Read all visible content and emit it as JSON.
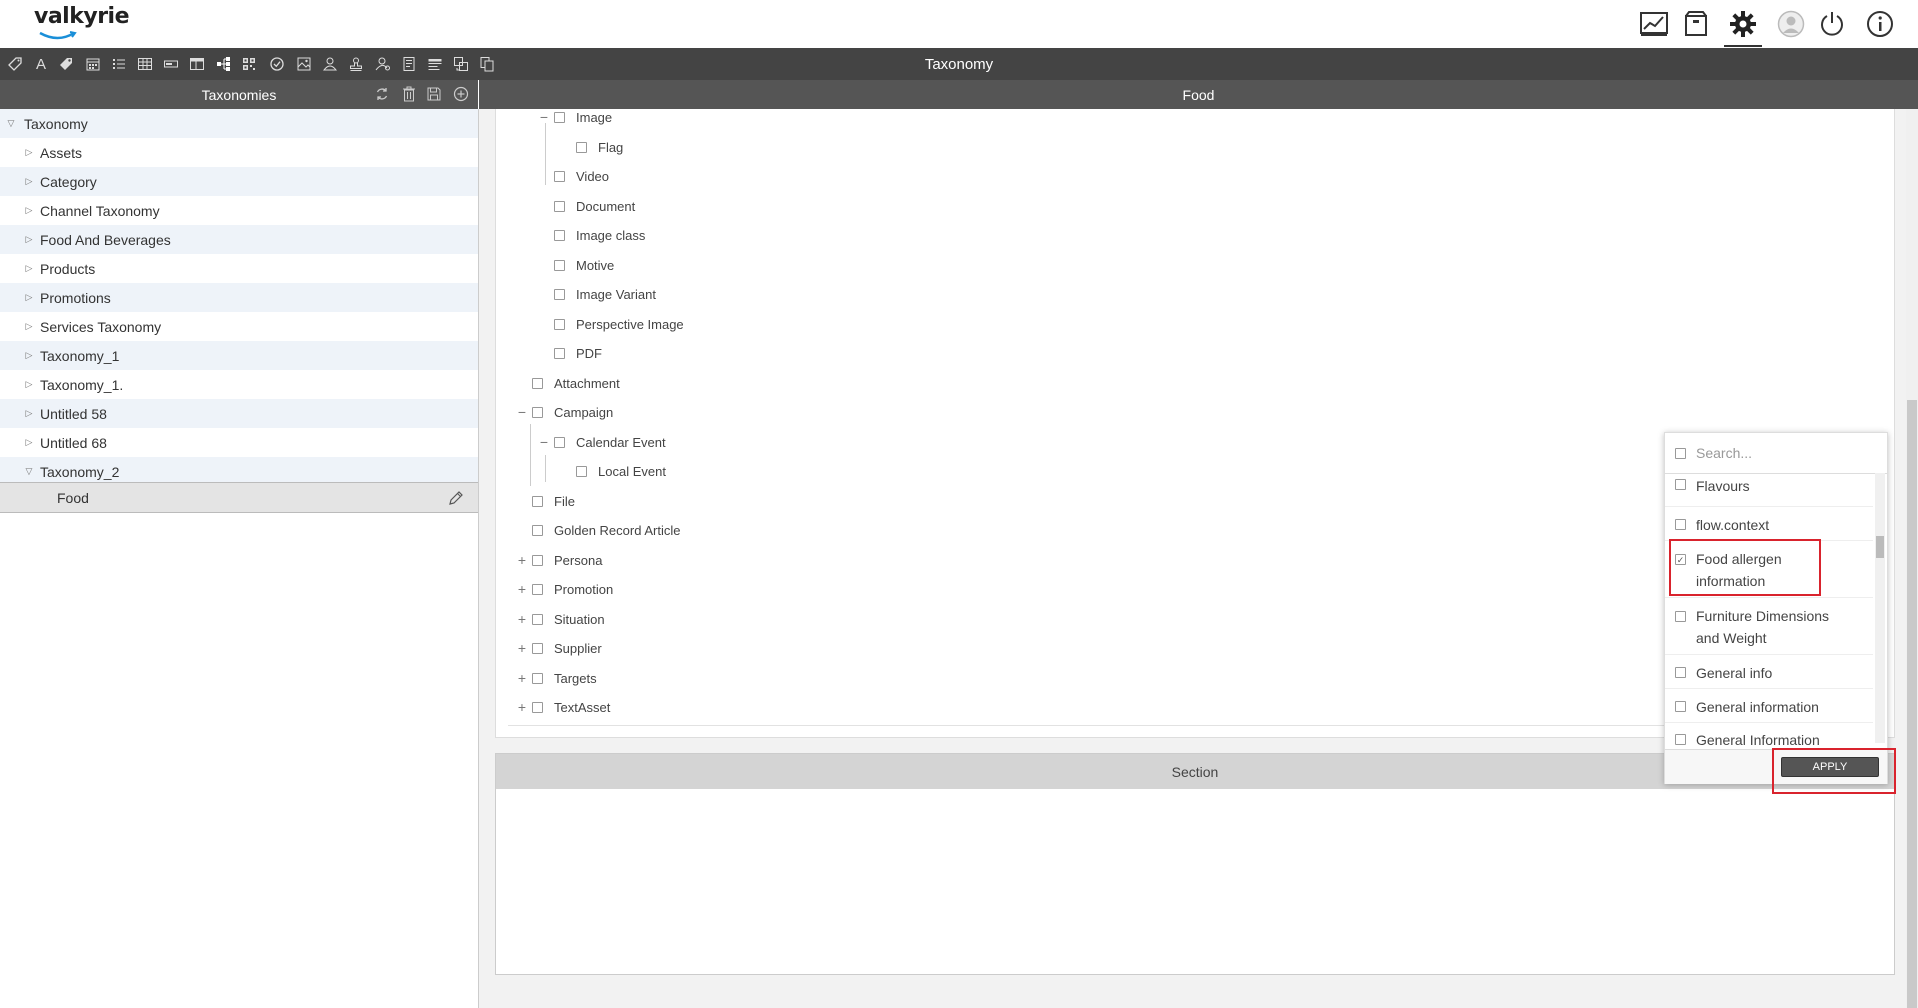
{
  "app": {
    "logo_text": "valkyrie"
  },
  "toolbar": {
    "title": "Taxonomy"
  },
  "left_panel": {
    "title": "Taxonomies",
    "tree": [
      {
        "label": "Taxonomy",
        "expanded": true,
        "level": 0
      },
      {
        "label": "Assets",
        "level": 1
      },
      {
        "label": "Category",
        "level": 1
      },
      {
        "label": "Channel Taxonomy",
        "level": 1
      },
      {
        "label": "Food And Beverages",
        "level": 1
      },
      {
        "label": "Products",
        "level": 1
      },
      {
        "label": "Promotions",
        "level": 1
      },
      {
        "label": "Services Taxonomy",
        "level": 1
      },
      {
        "label": "Taxonomy_1",
        "level": 1
      },
      {
        "label": "Taxonomy_1.",
        "level": 1
      },
      {
        "label": "Untitled 58",
        "level": 1
      },
      {
        "label": "Untitled 68",
        "level": 1
      },
      {
        "label": "Taxonomy_2",
        "expanded": true,
        "level": 1
      },
      {
        "label": "Food",
        "level": 2,
        "selected": true
      }
    ]
  },
  "main": {
    "title": "Food",
    "tree": [
      {
        "label": "Image",
        "level": 2,
        "toggle": "minus"
      },
      {
        "label": "Flag",
        "level": 3
      },
      {
        "label": "Video",
        "level": 2
      },
      {
        "label": "Document",
        "level": 2
      },
      {
        "label": "Image class",
        "level": 2
      },
      {
        "label": "Motive",
        "level": 2
      },
      {
        "label": "Image Variant",
        "level": 2
      },
      {
        "label": "Perspective Image",
        "level": 2
      },
      {
        "label": "PDF",
        "level": 2
      },
      {
        "label": "Attachment",
        "level": 1
      },
      {
        "label": "Campaign",
        "level": 1,
        "toggle": "minus"
      },
      {
        "label": "Calendar Event",
        "level": 2,
        "toggle": "minus"
      },
      {
        "label": "Local Event",
        "level": 3
      },
      {
        "label": "File",
        "level": 1
      },
      {
        "label": "Golden Record Article",
        "level": 1
      },
      {
        "label": "Persona",
        "level": 1,
        "toggle": "plus"
      },
      {
        "label": "Promotion",
        "level": 1,
        "toggle": "plus"
      },
      {
        "label": "Situation",
        "level": 1,
        "toggle": "plus"
      },
      {
        "label": "Supplier",
        "level": 1,
        "toggle": "plus"
      },
      {
        "label": "Targets",
        "level": 1,
        "toggle": "plus"
      },
      {
        "label": "TextAsset",
        "level": 1,
        "toggle": "plus"
      }
    ],
    "section_title": "Section"
  },
  "dropdown": {
    "search_placeholder": "Search...",
    "items": [
      {
        "label": "Flavours",
        "checked": false
      },
      {
        "label": "flow.context",
        "checked": false
      },
      {
        "label": "Food allergen information",
        "checked": true
      },
      {
        "label": "Furniture Dimensions and Weight",
        "checked": false
      },
      {
        "label": "General info",
        "checked": false
      },
      {
        "label": "General information",
        "checked": false
      },
      {
        "label": "General Information",
        "checked": false
      }
    ],
    "apply_label": "APPLY"
  },
  "colors": {
    "dark_bar": "#444444",
    "panel_header": "#555555",
    "highlight_red": "#d9232d",
    "alt_row": "#eef3f9"
  }
}
